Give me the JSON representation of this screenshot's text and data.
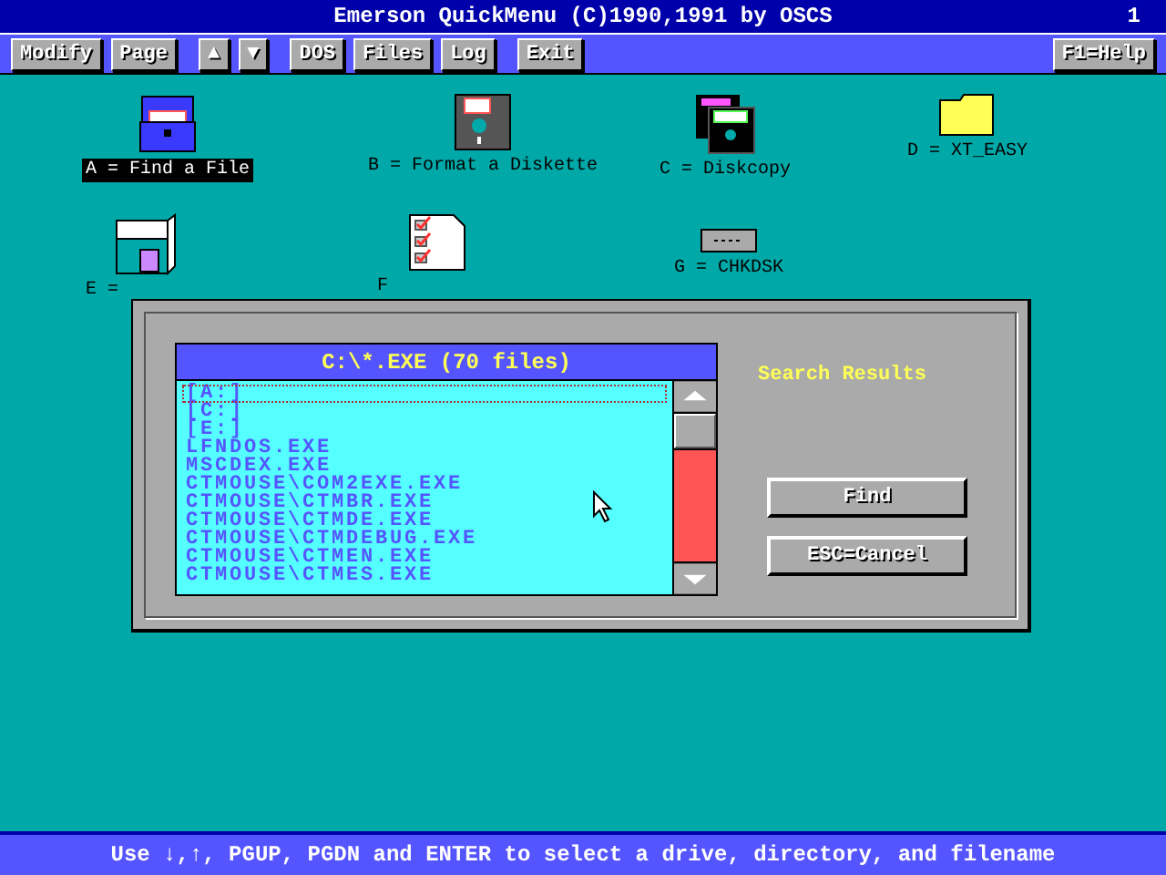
{
  "window": {
    "title": "Emerson QuickMenu (C)1990,1991 by OSCS",
    "page_number": "1"
  },
  "toolbar": {
    "groups": [
      [
        {
          "label": "Modify"
        },
        {
          "label": "Page"
        }
      ],
      [
        {
          "label": "▲"
        },
        {
          "label": "▼"
        }
      ],
      [
        {
          "label": "DOS"
        },
        {
          "label": "Files"
        },
        {
          "label": "Log"
        }
      ],
      [
        {
          "label": "Exit"
        }
      ]
    ],
    "right": [
      {
        "label": "F1=Help"
      }
    ]
  },
  "desktop_items": [
    {
      "label": "A = Find a File",
      "kind": "chest",
      "selected": true
    },
    {
      "label": "B = Format a Diskette",
      "kind": "diskette",
      "selected": false
    },
    {
      "label": "C = Diskcopy",
      "kind": "diskcopy",
      "selected": false
    },
    {
      "label": "D = XT_EASY",
      "kind": "folder",
      "selected": false
    },
    {
      "label": "E =",
      "kind": "computer",
      "selected": false
    },
    {
      "label": "F",
      "kind": "checklist",
      "selected": false
    },
    {
      "label": "G = CHKDSK",
      "kind": "drive",
      "selected": false
    }
  ],
  "dialog": {
    "list_header": "C:\\*.EXE (70 files)",
    "heading": "Search Results",
    "files": [
      {
        "name": "[A:]",
        "selected": true
      },
      {
        "name": "[C:]",
        "selected": false
      },
      {
        "name": "[E:]",
        "selected": false
      },
      {
        "name": "LFNDOS.EXE",
        "selected": false
      },
      {
        "name": "MSCDEX.EXE",
        "selected": false
      },
      {
        "name": "CTMOUSE\\COM2EXE.EXE",
        "selected": false
      },
      {
        "name": "CTMOUSE\\CTMBR.EXE",
        "selected": false
      },
      {
        "name": "CTMOUSE\\CTMDE.EXE",
        "selected": false
      },
      {
        "name": "CTMOUSE\\CTMDEBUG.EXE",
        "selected": false
      },
      {
        "name": "CTMOUSE\\CTMEN.EXE",
        "selected": false
      },
      {
        "name": "CTMOUSE\\CTMES.EXE",
        "selected": false
      }
    ],
    "buttons": [
      {
        "label": "Find"
      },
      {
        "label": "ESC=Cancel"
      }
    ]
  },
  "status_bar": "Use ↓,↑, PGUP, PGDN and ENTER to select a drive, directory, and filename"
}
